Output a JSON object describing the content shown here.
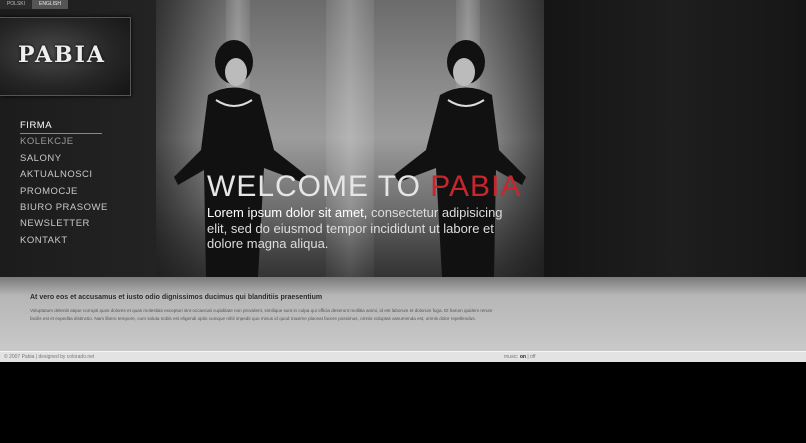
{
  "lang": {
    "polski": "POLSKI",
    "english": "ENGLISH"
  },
  "logo": "PABIA",
  "nav": [
    {
      "label": "FIRMA",
      "active": true
    },
    {
      "label": "KOLEKCJE"
    },
    {
      "label": "SALONY"
    },
    {
      "label": "AKTUALNOSCI"
    },
    {
      "label": "PROMOCJE"
    },
    {
      "label": "BIURO PRASOWE"
    },
    {
      "label": "NEWSLETTER"
    },
    {
      "label": "KONTAKT"
    }
  ],
  "hero": {
    "welcome": "WELCOME TO",
    "brand": "PABIA",
    "lorem_bold": "Lorem ipsum dolor sit amet,",
    "lorem_rest": " consectetur adipisicing elit, sed do eiusmod tempor incididunt ut labore et dolore magna aliqua.",
    "accent_color": "#c8262d"
  },
  "content": {
    "title": "At vero eos et accusamus et iusto odio dignissimos ducimus qui blanditiis praesentium",
    "text": "Voluptatum deleniti atque corrupti quos dolores et quas molestias excepturi sint occaecati cupiditate non provident, similique sunt in culpa qui officia deserunt mollitia animi, id est laborum et dolorum fuga. Et harum quidem rerum facilis est et expedita distinctio. Nam libero tempore, cum soluta nobis est eligendi optio cumque nihil impedit quo minus id quod maxime placeat facere possimus, omnis voluptas assumenda est, omnis dolor repellendus."
  },
  "footer": {
    "copyright": "© 2007 Pabia  |  designed by colorado.net",
    "music_label": "music:",
    "on": "on",
    "sep": " | ",
    "off": "off"
  }
}
